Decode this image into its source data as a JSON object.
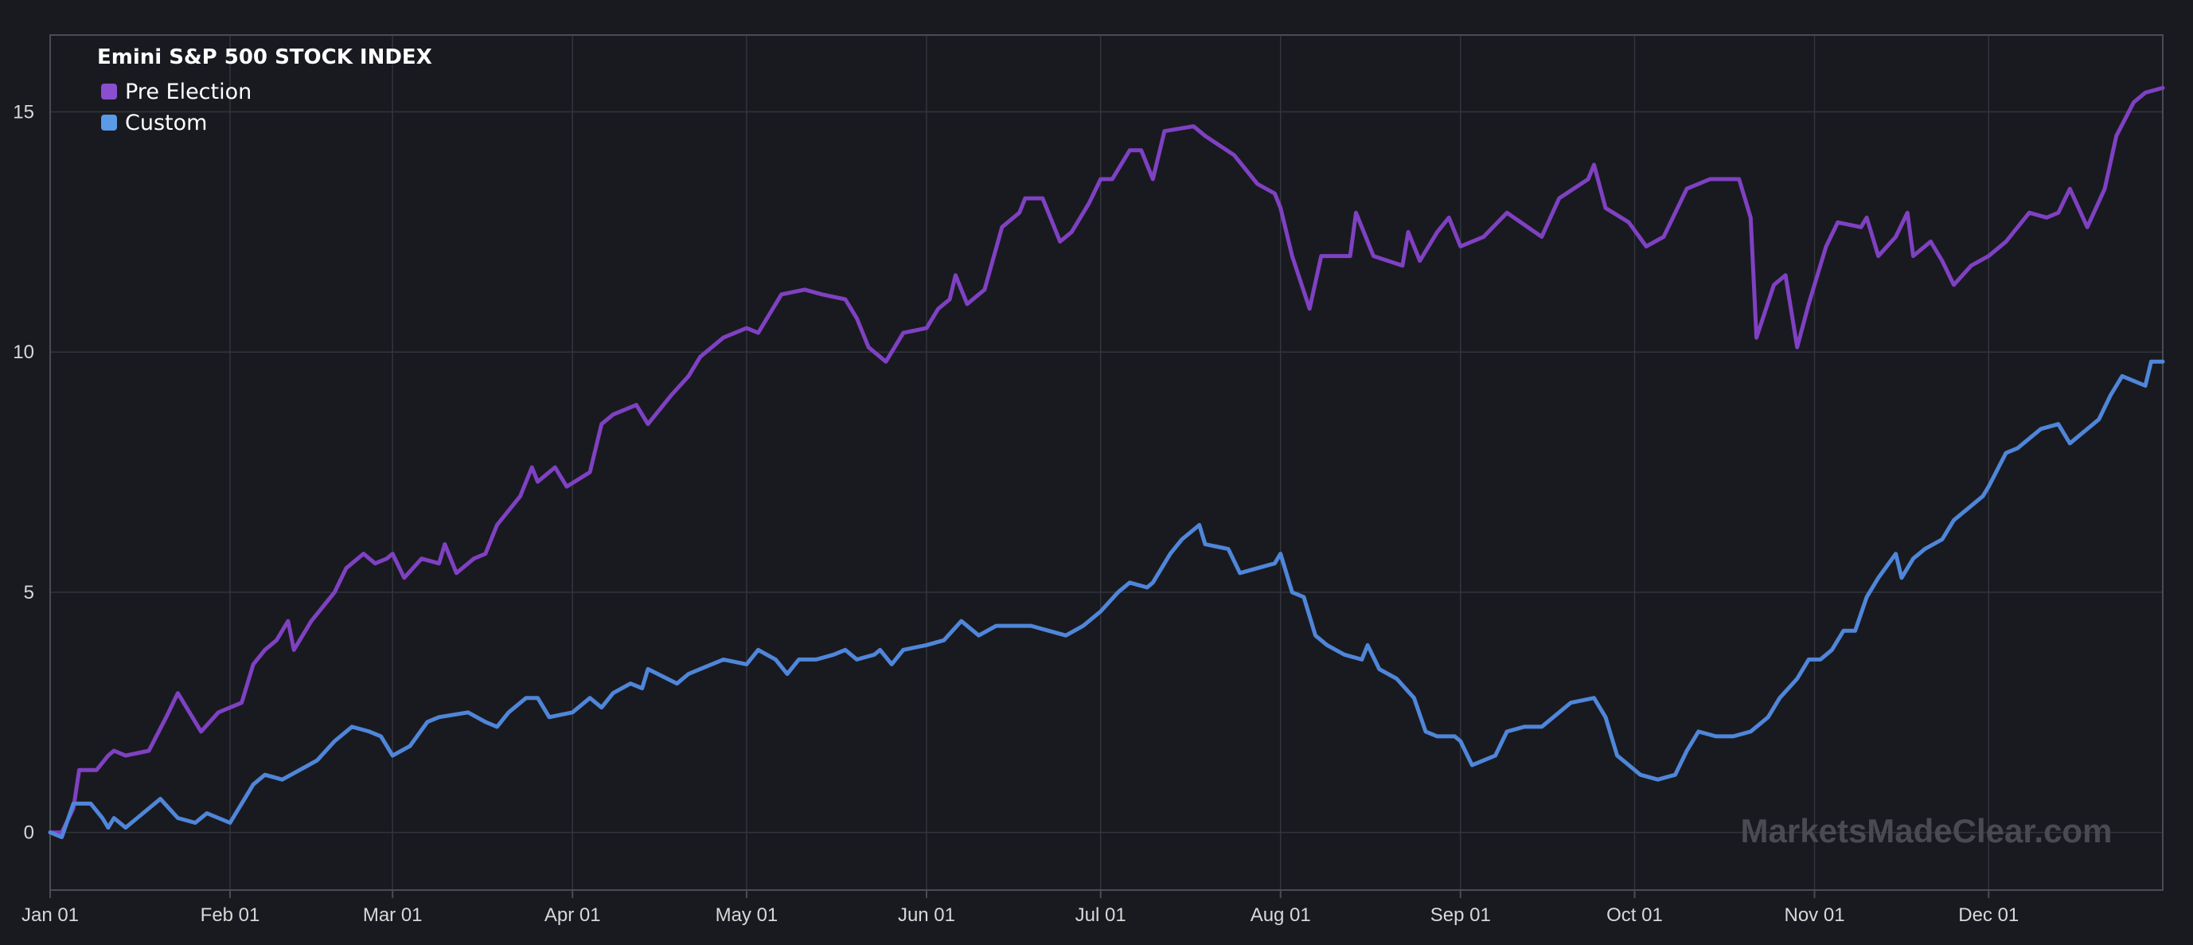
{
  "watermark": "MarketsMadeClear.com",
  "colors": {
    "background": "#191a20",
    "grid": "#33353c",
    "axis": "#4a4c54",
    "pre_election": "#7f41c2",
    "custom": "#4f86d9",
    "legend_pre": "#8a4fcf",
    "legend_custom": "#5a9ae6"
  },
  "chart_data": {
    "type": "line",
    "title": "Emini S&P 500 STOCK INDEX",
    "xlabel": "",
    "ylabel": "",
    "legend_position": "top-left",
    "grid": true,
    "x_range": [
      "Jan 01",
      "Dec 31"
    ],
    "ylim": [
      -1.2,
      16.6
    ],
    "x_ticks": [
      "Jan 01",
      "Feb 01",
      "Mar 01",
      "Apr 01",
      "May 01",
      "Jun 01",
      "Jul 01",
      "Aug 01",
      "Sep 01",
      "Oct 01",
      "Nov 01",
      "Dec 01"
    ],
    "y_ticks": [
      0,
      5,
      10,
      15
    ],
    "series": [
      {
        "name": "Pre Election",
        "points": [
          [
            "Jan 01",
            0.0
          ],
          [
            "Jan 03",
            0.0
          ],
          [
            "Jan 05",
            0.5
          ],
          [
            "Jan 06",
            1.3
          ],
          [
            "Jan 09",
            1.3
          ],
          [
            "Jan 11",
            1.6
          ],
          [
            "Jan 12",
            1.7
          ],
          [
            "Jan 14",
            1.6
          ],
          [
            "Jan 18",
            1.7
          ],
          [
            "Jan 21",
            2.4
          ],
          [
            "Jan 23",
            2.9
          ],
          [
            "Jan 27",
            2.1
          ],
          [
            "Jan 30",
            2.5
          ],
          [
            "Feb 01",
            2.6
          ],
          [
            "Feb 03",
            2.7
          ],
          [
            "Feb 05",
            3.5
          ],
          [
            "Feb 07",
            3.8
          ],
          [
            "Feb 09",
            4.0
          ],
          [
            "Feb 11",
            4.4
          ],
          [
            "Feb 12",
            3.8
          ],
          [
            "Feb 15",
            4.4
          ],
          [
            "Feb 17",
            4.7
          ],
          [
            "Feb 19",
            5.0
          ],
          [
            "Feb 21",
            5.5
          ],
          [
            "Feb 24",
            5.8
          ],
          [
            "Feb 26",
            5.6
          ],
          [
            "Feb 28",
            5.7
          ],
          [
            "Mar 01",
            5.8
          ],
          [
            "Mar 03",
            5.3
          ],
          [
            "Mar 06",
            5.7
          ],
          [
            "Mar 09",
            5.6
          ],
          [
            "Mar 10",
            6.0
          ],
          [
            "Mar 12",
            5.4
          ],
          [
            "Mar 15",
            5.7
          ],
          [
            "Mar 17",
            5.8
          ],
          [
            "Mar 19",
            6.4
          ],
          [
            "Mar 23",
            7.0
          ],
          [
            "Mar 25",
            7.6
          ],
          [
            "Mar 26",
            7.3
          ],
          [
            "Mar 29",
            7.6
          ],
          [
            "Mar 31",
            7.2
          ],
          [
            "Apr 04",
            7.5
          ],
          [
            "Apr 06",
            8.5
          ],
          [
            "Apr 08",
            8.7
          ],
          [
            "Apr 12",
            8.9
          ],
          [
            "Apr 14",
            8.5
          ],
          [
            "Apr 18",
            9.1
          ],
          [
            "Apr 21",
            9.5
          ],
          [
            "Apr 23",
            9.9
          ],
          [
            "Apr 27",
            10.3
          ],
          [
            "May 01",
            10.5
          ],
          [
            "May 03",
            10.4
          ],
          [
            "May 07",
            11.2
          ],
          [
            "May 11",
            11.3
          ],
          [
            "May 14",
            11.2
          ],
          [
            "May 18",
            11.1
          ],
          [
            "May 20",
            10.7
          ],
          [
            "May 22",
            10.1
          ],
          [
            "May 25",
            9.8
          ],
          [
            "May 28",
            10.4
          ],
          [
            "Jun 01",
            10.5
          ],
          [
            "Jun 03",
            10.9
          ],
          [
            "Jun 05",
            11.1
          ],
          [
            "Jun 06",
            11.6
          ],
          [
            "Jun 08",
            11.0
          ],
          [
            "Jun 11",
            11.3
          ],
          [
            "Jun 14",
            12.6
          ],
          [
            "Jun 17",
            12.9
          ],
          [
            "Jun 18",
            13.2
          ],
          [
            "Jun 21",
            13.2
          ],
          [
            "Jun 24",
            12.3
          ],
          [
            "Jun 26",
            12.5
          ],
          [
            "Jun 29",
            13.1
          ],
          [
            "Jul 01",
            13.6
          ],
          [
            "Jul 03",
            13.6
          ],
          [
            "Jul 06",
            14.2
          ],
          [
            "Jul 08",
            14.2
          ],
          [
            "Jul 10",
            13.6
          ],
          [
            "Jul 12",
            14.6
          ],
          [
            "Jul 17",
            14.7
          ],
          [
            "Jul 19",
            14.5
          ],
          [
            "Jul 24",
            14.1
          ],
          [
            "Jul 28",
            13.5
          ],
          [
            "Jul 31",
            13.3
          ],
          [
            "Aug 01",
            13.0
          ],
          [
            "Aug 03",
            12.0
          ],
          [
            "Aug 06",
            10.9
          ],
          [
            "Aug 08",
            12.0
          ],
          [
            "Aug 13",
            12.0
          ],
          [
            "Aug 14",
            12.9
          ],
          [
            "Aug 17",
            12.0
          ],
          [
            "Aug 22",
            11.8
          ],
          [
            "Aug 23",
            12.5
          ],
          [
            "Aug 25",
            11.9
          ],
          [
            "Aug 28",
            12.5
          ],
          [
            "Aug 30",
            12.8
          ],
          [
            "Sep 01",
            12.2
          ],
          [
            "Sep 05",
            12.4
          ],
          [
            "Sep 09",
            12.9
          ],
          [
            "Sep 15",
            12.4
          ],
          [
            "Sep 18",
            13.2
          ],
          [
            "Sep 23",
            13.6
          ],
          [
            "Sep 24",
            13.9
          ],
          [
            "Sep 26",
            13.0
          ],
          [
            "Sep 30",
            12.7
          ],
          [
            "Oct 03",
            12.2
          ],
          [
            "Oct 06",
            12.4
          ],
          [
            "Oct 10",
            13.4
          ],
          [
            "Oct 14",
            13.6
          ],
          [
            "Oct 17",
            13.6
          ],
          [
            "Oct 19",
            13.6
          ],
          [
            "Oct 21",
            12.8
          ],
          [
            "Oct 22",
            10.3
          ],
          [
            "Oct 25",
            11.4
          ],
          [
            "Oct 27",
            11.6
          ],
          [
            "Oct 29",
            10.1
          ],
          [
            "Oct 31",
            11.0
          ],
          [
            "Nov 03",
            12.2
          ],
          [
            "Nov 05",
            12.7
          ],
          [
            "Nov 09",
            12.6
          ],
          [
            "Nov 10",
            12.8
          ],
          [
            "Nov 12",
            12.0
          ],
          [
            "Nov 15",
            12.4
          ],
          [
            "Nov 17",
            12.9
          ],
          [
            "Nov 18",
            12.0
          ],
          [
            "Nov 21",
            12.3
          ],
          [
            "Nov 23",
            11.9
          ],
          [
            "Nov 25",
            11.4
          ],
          [
            "Nov 28",
            11.8
          ],
          [
            "Dec 01",
            12.0
          ],
          [
            "Dec 04",
            12.3
          ],
          [
            "Dec 08",
            12.9
          ],
          [
            "Dec 11",
            12.8
          ],
          [
            "Dec 13",
            12.9
          ],
          [
            "Dec 15",
            13.4
          ],
          [
            "Dec 18",
            12.6
          ],
          [
            "Dec 21",
            13.4
          ],
          [
            "Dec 23",
            14.5
          ],
          [
            "Dec 26",
            15.2
          ],
          [
            "Dec 28",
            15.4
          ],
          [
            "Dec 31",
            15.5
          ]
        ]
      },
      {
        "name": "Custom",
        "points": [
          [
            "Jan 01",
            0.0
          ],
          [
            "Jan 03",
            -0.1
          ],
          [
            "Jan 05",
            0.6
          ],
          [
            "Jan 08",
            0.6
          ],
          [
            "Jan 10",
            0.3
          ],
          [
            "Jan 11",
            0.1
          ],
          [
            "Jan 12",
            0.3
          ],
          [
            "Jan 14",
            0.1
          ],
          [
            "Jan 16",
            0.3
          ],
          [
            "Jan 18",
            0.5
          ],
          [
            "Jan 20",
            0.7
          ],
          [
            "Jan 23",
            0.3
          ],
          [
            "Jan 26",
            0.2
          ],
          [
            "Jan 28",
            0.4
          ],
          [
            "Jan 30",
            0.3
          ],
          [
            "Feb 01",
            0.2
          ],
          [
            "Feb 03",
            0.6
          ],
          [
            "Feb 05",
            1.0
          ],
          [
            "Feb 07",
            1.2
          ],
          [
            "Feb 10",
            1.1
          ],
          [
            "Feb 13",
            1.3
          ],
          [
            "Feb 16",
            1.5
          ],
          [
            "Feb 19",
            1.9
          ],
          [
            "Feb 22",
            2.2
          ],
          [
            "Feb 25",
            2.1
          ],
          [
            "Feb 27",
            2.0
          ],
          [
            "Mar 01",
            1.6
          ],
          [
            "Mar 04",
            1.8
          ],
          [
            "Mar 07",
            2.3
          ],
          [
            "Mar 09",
            2.4
          ],
          [
            "Mar 14",
            2.5
          ],
          [
            "Mar 17",
            2.3
          ],
          [
            "Mar 19",
            2.2
          ],
          [
            "Mar 21",
            2.5
          ],
          [
            "Mar 24",
            2.8
          ],
          [
            "Mar 26",
            2.8
          ],
          [
            "Mar 28",
            2.4
          ],
          [
            "Apr 01",
            2.5
          ],
          [
            "Apr 04",
            2.8
          ],
          [
            "Apr 06",
            2.6
          ],
          [
            "Apr 08",
            2.9
          ],
          [
            "Apr 11",
            3.1
          ],
          [
            "Apr 13",
            3.0
          ],
          [
            "Apr 14",
            3.4
          ],
          [
            "Apr 19",
            3.1
          ],
          [
            "Apr 21",
            3.3
          ],
          [
            "Apr 25",
            3.5
          ],
          [
            "Apr 27",
            3.6
          ],
          [
            "May 01",
            3.5
          ],
          [
            "May 03",
            3.8
          ],
          [
            "May 06",
            3.6
          ],
          [
            "May 08",
            3.3
          ],
          [
            "May 10",
            3.6
          ],
          [
            "May 13",
            3.6
          ],
          [
            "May 16",
            3.7
          ],
          [
            "May 18",
            3.8
          ],
          [
            "May 20",
            3.6
          ],
          [
            "May 23",
            3.7
          ],
          [
            "May 24",
            3.8
          ],
          [
            "May 26",
            3.5
          ],
          [
            "May 28",
            3.8
          ],
          [
            "Jun 01",
            3.9
          ],
          [
            "Jun 04",
            4.0
          ],
          [
            "Jun 07",
            4.4
          ],
          [
            "Jun 10",
            4.1
          ],
          [
            "Jun 13",
            4.3
          ],
          [
            "Jun 16",
            4.3
          ],
          [
            "Jun 19",
            4.3
          ],
          [
            "Jun 22",
            4.2
          ],
          [
            "Jun 25",
            4.1
          ],
          [
            "Jun 28",
            4.3
          ],
          [
            "Jul 01",
            4.6
          ],
          [
            "Jul 04",
            5.0
          ],
          [
            "Jul 06",
            5.2
          ],
          [
            "Jul 09",
            5.1
          ],
          [
            "Jul 10",
            5.2
          ],
          [
            "Jul 13",
            5.8
          ],
          [
            "Jul 15",
            6.1
          ],
          [
            "Jul 18",
            6.4
          ],
          [
            "Jul 19",
            6.0
          ],
          [
            "Jul 23",
            5.9
          ],
          [
            "Jul 25",
            5.4
          ],
          [
            "Jul 28",
            5.5
          ],
          [
            "Jul 31",
            5.6
          ],
          [
            "Aug 01",
            5.8
          ],
          [
            "Aug 03",
            5.0
          ],
          [
            "Aug 05",
            4.9
          ],
          [
            "Aug 07",
            4.1
          ],
          [
            "Aug 09",
            3.9
          ],
          [
            "Aug 12",
            3.7
          ],
          [
            "Aug 15",
            3.6
          ],
          [
            "Aug 16",
            3.9
          ],
          [
            "Aug 18",
            3.4
          ],
          [
            "Aug 21",
            3.2
          ],
          [
            "Aug 24",
            2.8
          ],
          [
            "Aug 26",
            2.1
          ],
          [
            "Aug 28",
            2.0
          ],
          [
            "Aug 31",
            2.0
          ],
          [
            "Sep 01",
            1.9
          ],
          [
            "Sep 03",
            1.4
          ],
          [
            "Sep 07",
            1.6
          ],
          [
            "Sep 09",
            2.1
          ],
          [
            "Sep 12",
            2.2
          ],
          [
            "Sep 15",
            2.2
          ],
          [
            "Sep 18",
            2.5
          ],
          [
            "Sep 20",
            2.7
          ],
          [
            "Sep 24",
            2.8
          ],
          [
            "Sep 26",
            2.4
          ],
          [
            "Sep 28",
            1.6
          ],
          [
            "Sep 30",
            1.4
          ],
          [
            "Oct 02",
            1.2
          ],
          [
            "Oct 05",
            1.1
          ],
          [
            "Oct 08",
            1.2
          ],
          [
            "Oct 10",
            1.7
          ],
          [
            "Oct 12",
            2.1
          ],
          [
            "Oct 15",
            2.0
          ],
          [
            "Oct 18",
            2.0
          ],
          [
            "Oct 21",
            2.1
          ],
          [
            "Oct 24",
            2.4
          ],
          [
            "Oct 26",
            2.8
          ],
          [
            "Oct 29",
            3.2
          ],
          [
            "Oct 31",
            3.6
          ],
          [
            "Nov 02",
            3.6
          ],
          [
            "Nov 04",
            3.8
          ],
          [
            "Nov 06",
            4.2
          ],
          [
            "Nov 08",
            4.2
          ],
          [
            "Nov 10",
            4.9
          ],
          [
            "Nov 12",
            5.3
          ],
          [
            "Nov 15",
            5.8
          ],
          [
            "Nov 16",
            5.3
          ],
          [
            "Nov 18",
            5.7
          ],
          [
            "Nov 20",
            5.9
          ],
          [
            "Nov 23",
            6.1
          ],
          [
            "Nov 25",
            6.5
          ],
          [
            "Nov 28",
            6.8
          ],
          [
            "Nov 30",
            7.0
          ],
          [
            "Dec 01",
            7.2
          ],
          [
            "Dec 04",
            7.9
          ],
          [
            "Dec 06",
            8.0
          ],
          [
            "Dec 08",
            8.2
          ],
          [
            "Dec 10",
            8.4
          ],
          [
            "Dec 13",
            8.5
          ],
          [
            "Dec 15",
            8.1
          ],
          [
            "Dec 18",
            8.4
          ],
          [
            "Dec 20",
            8.6
          ],
          [
            "Dec 22",
            9.1
          ],
          [
            "Dec 24",
            9.5
          ],
          [
            "Dec 26",
            9.4
          ],
          [
            "Dec 28",
            9.3
          ],
          [
            "Dec 29",
            9.8
          ],
          [
            "Dec 31",
            9.8
          ]
        ]
      }
    ]
  }
}
